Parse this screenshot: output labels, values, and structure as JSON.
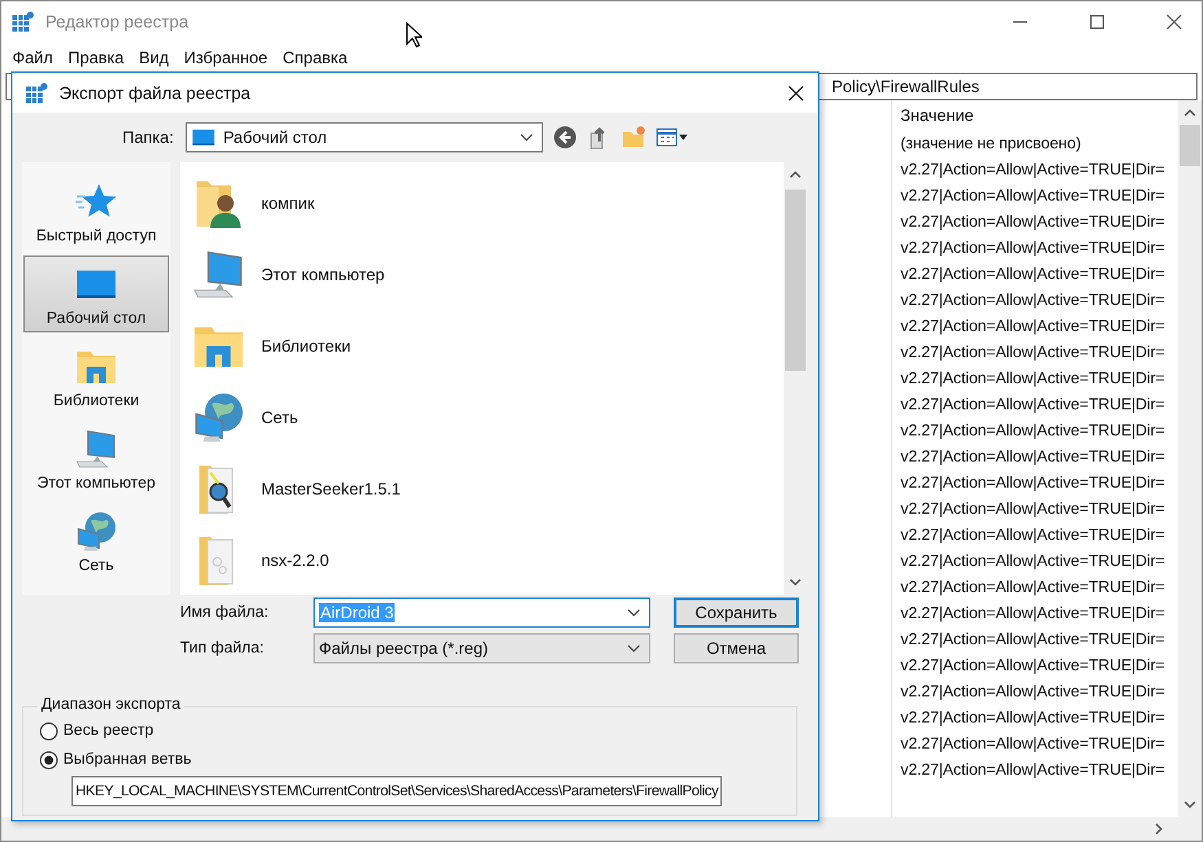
{
  "main_window": {
    "title": "Редактор реестра",
    "menu": [
      "Файл",
      "Правка",
      "Вид",
      "Избранное",
      "Справка"
    ],
    "address": "Policy\\FirewallRules",
    "values_header": "Значение",
    "values": [
      "(значение не присвоено)",
      "v2.27|Action=Allow|Active=TRUE|Dir=",
      "v2.27|Action=Allow|Active=TRUE|Dir=",
      "v2.27|Action=Allow|Active=TRUE|Dir=",
      "v2.27|Action=Allow|Active=TRUE|Dir=",
      "v2.27|Action=Allow|Active=TRUE|Dir=",
      "v2.27|Action=Allow|Active=TRUE|Dir=",
      "v2.27|Action=Allow|Active=TRUE|Dir=",
      "v2.27|Action=Allow|Active=TRUE|Dir=",
      "v2.27|Action=Allow|Active=TRUE|Dir=",
      "v2.27|Action=Allow|Active=TRUE|Dir=",
      "v2.27|Action=Allow|Active=TRUE|Dir=",
      "v2.27|Action=Allow|Active=TRUE|Dir=",
      "v2.27|Action=Allow|Active=TRUE|Dir=",
      "v2.27|Action=Allow|Active=TRUE|Dir=",
      "v2.27|Action=Allow|Active=TRUE|Dir=",
      "v2.27|Action=Allow|Active=TRUE|Dir=",
      "v2.27|Action=Allow|Active=TRUE|Dir=",
      "v2.27|Action=Allow|Active=TRUE|Dir=",
      "v2.27|Action=Allow|Active=TRUE|Dir=",
      "v2.27|Action=Allow|Active=TRUE|Dir=",
      "v2.27|Action=Allow|Active=TRUE|Dir=",
      "v2.27|Action=Allow|Active=TRUE|Dir=",
      "v2.27|Action=Allow|Active=TRUE|Dir=",
      "v2.27|Action=Allow|Active=TRUE|Dir="
    ]
  },
  "dialog": {
    "title": "Экспорт файла реестра",
    "folder_label": "Папка:",
    "folder": "Рабочий стол",
    "places": [
      {
        "label": "Быстрый доступ",
        "kind": "star",
        "selected": false
      },
      {
        "label": "Рабочий стол",
        "kind": "desktop",
        "selected": true
      },
      {
        "label": "Библиотеки",
        "kind": "library",
        "selected": false
      },
      {
        "label": "Этот компьютер",
        "kind": "computer",
        "selected": false
      },
      {
        "label": "Сеть",
        "kind": "network",
        "selected": false
      }
    ],
    "files": [
      {
        "name": "компик",
        "kind": "user"
      },
      {
        "name": "Этот компьютер",
        "kind": "computer"
      },
      {
        "name": "Библиотеки",
        "kind": "library"
      },
      {
        "name": "Сеть",
        "kind": "network"
      },
      {
        "name": "MasterSeeker1.5.1",
        "kind": "app"
      },
      {
        "name": "nsx-2.2.0",
        "kind": "folder"
      }
    ],
    "filename_label": "Имя файла:",
    "filename": "AirDroid 3",
    "filetype_label": "Тип файла:",
    "filetype": "Файлы реестра (*.reg)",
    "buttons": [
      "Сохранить",
      "Отмена"
    ],
    "range": {
      "title": "Диапазон экспорта",
      "options": [
        {
          "label": "Весь реестр",
          "selected": false
        },
        {
          "label": "Выбранная ветвь",
          "selected": true
        }
      ],
      "branch": "HKEY_LOCAL_MACHINE\\SYSTEM\\CurrentControlSet\\Services\\SharedAccess\\Parameters\\FirewallPolicy"
    }
  }
}
